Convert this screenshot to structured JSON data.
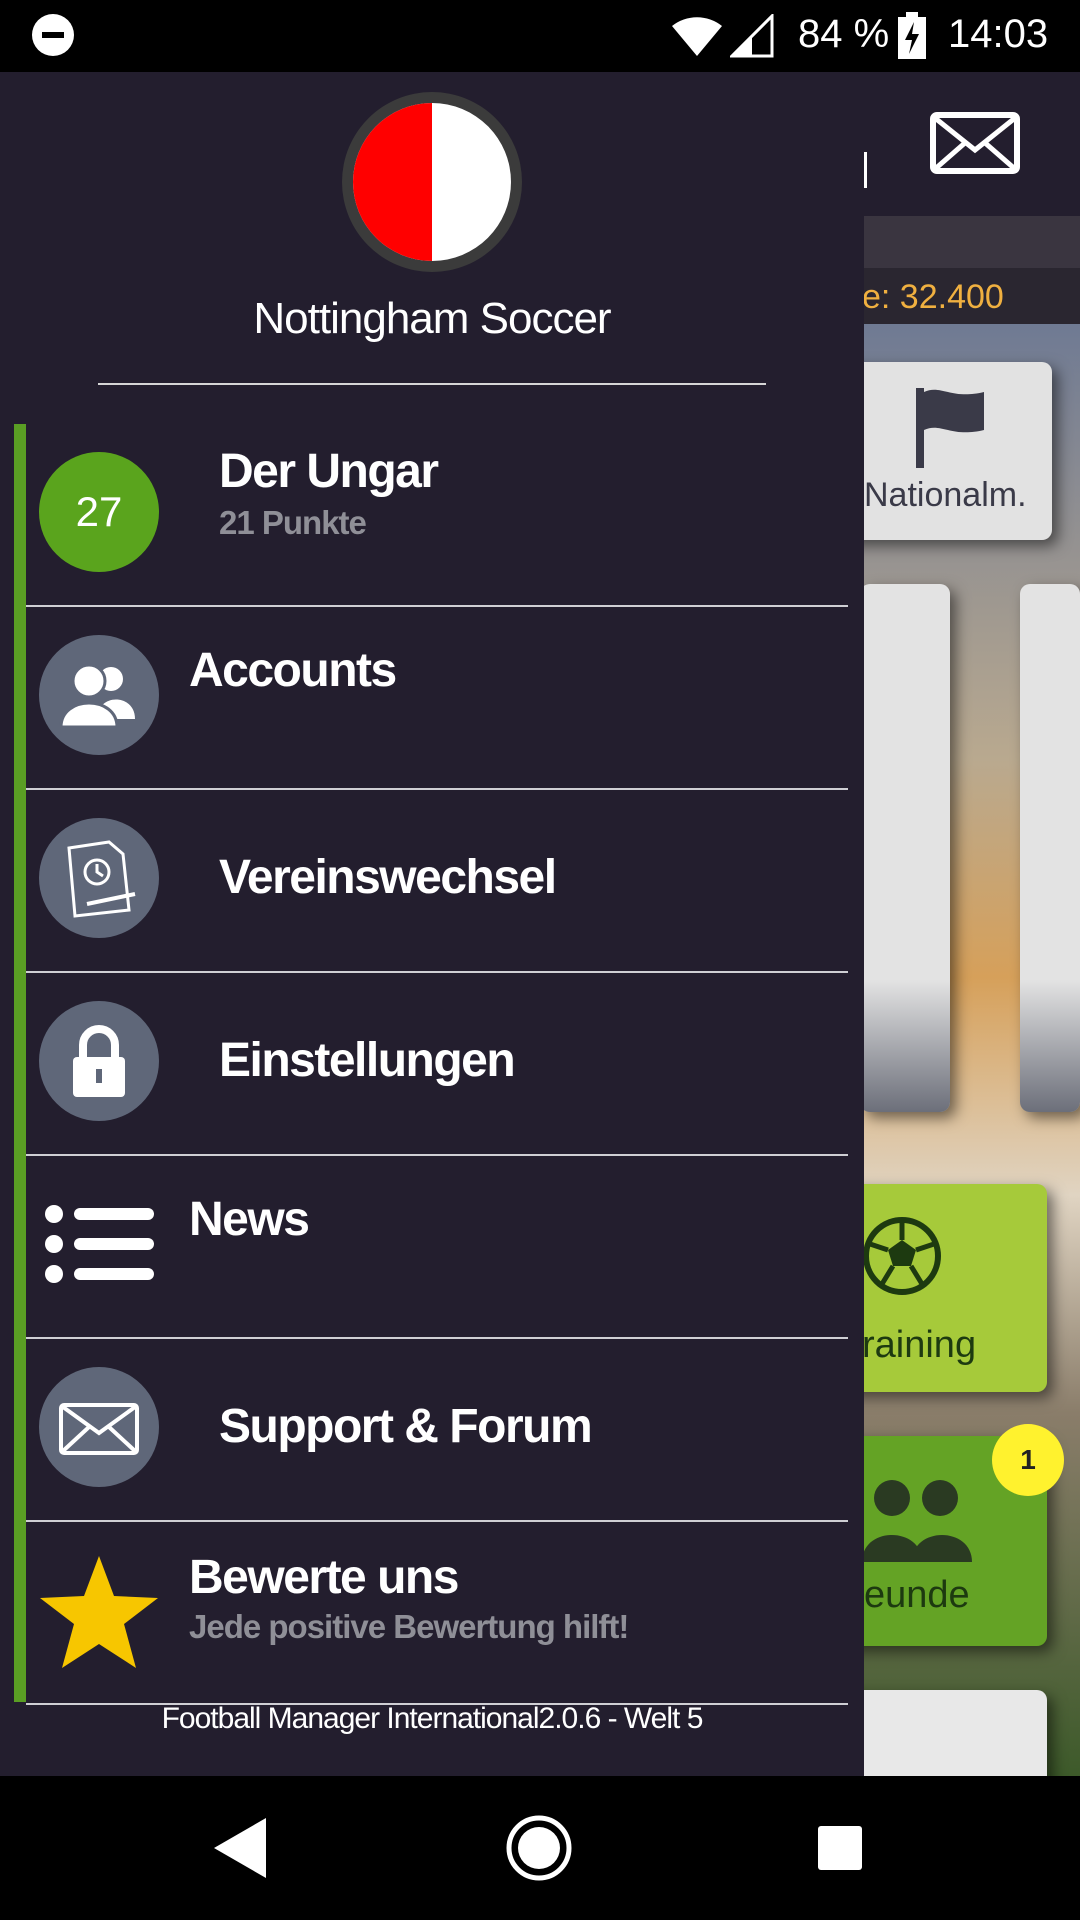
{
  "status_bar": {
    "battery_percent": "84 %",
    "time": "14:03"
  },
  "background_app": {
    "budget_text": "e: 32.400",
    "tiles": {
      "national": "Nationalm.",
      "training": "raining",
      "friends": "eunde",
      "friends_badge": "1"
    }
  },
  "drawer": {
    "club_name": "Nottingham Soccer",
    "club_colors": {
      "left": "#ff0000",
      "right": "#ffffff"
    },
    "profile": {
      "rank": "27",
      "name": "Der Ungar",
      "points": "21 Punkte"
    },
    "menu": [
      {
        "label": "Accounts",
        "icon": "users-icon"
      },
      {
        "label": "Vereinswechsel",
        "icon": "contract-icon"
      },
      {
        "label": "Einstellungen",
        "icon": "lock-icon"
      },
      {
        "label": "News",
        "icon": "list-icon"
      },
      {
        "label": "Support & Forum",
        "icon": "mail-icon"
      }
    ],
    "rate": {
      "title": "Bewerte uns",
      "subtitle": "Jede positive Bewertung hilft!"
    },
    "footer": "Football Manager International2.0.6 - Welt 5",
    "accent_color": "#5a9e24"
  }
}
